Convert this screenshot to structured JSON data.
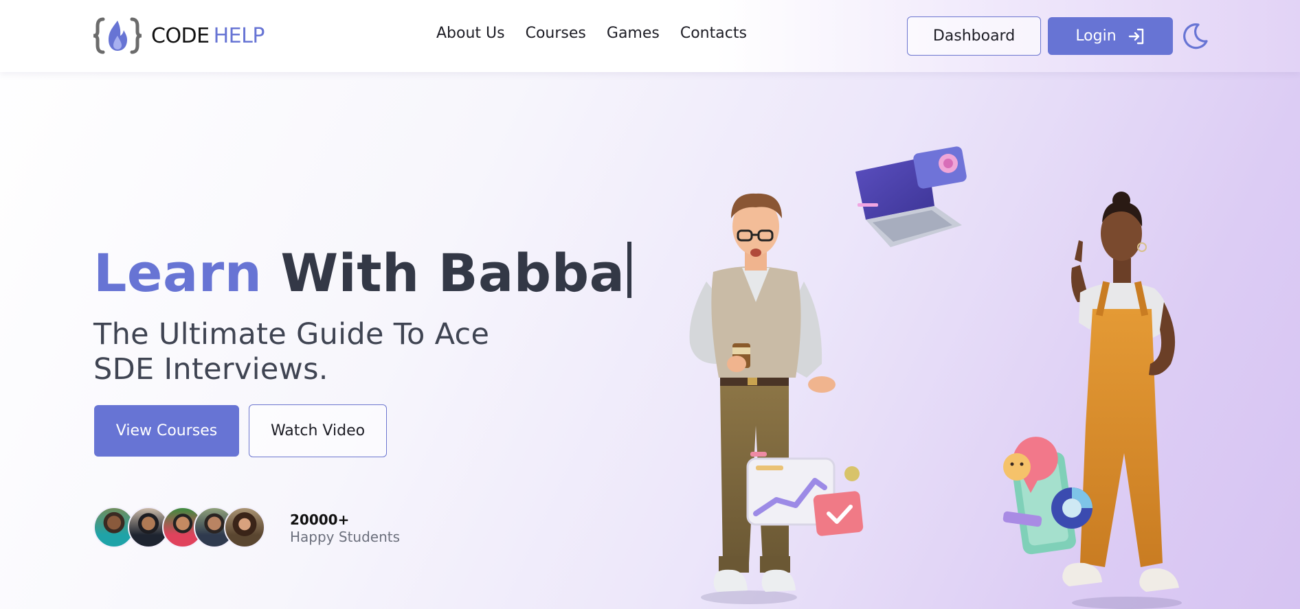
{
  "header": {
    "logo": {
      "word1": "CODE",
      "word2": "HELP"
    },
    "nav": [
      "About Us",
      "Courses",
      "Games",
      "Contacts"
    ],
    "dashboard_label": "Dashboard",
    "login_label": "Login",
    "theme_icon": "moon-icon"
  },
  "hero": {
    "title_accent": "Learn",
    "title_rest": "With Babba",
    "subtitle_line1": "The Ultimate Guide To Ace",
    "subtitle_line2": "SDE Interviews.",
    "primary_button": "View Courses",
    "secondary_button": "Watch Video"
  },
  "students": {
    "count": "20000+",
    "label": "Happy Students",
    "avatar_count": 5
  },
  "colors": {
    "accent": "#6774d4",
    "text_dark": "#333846"
  }
}
